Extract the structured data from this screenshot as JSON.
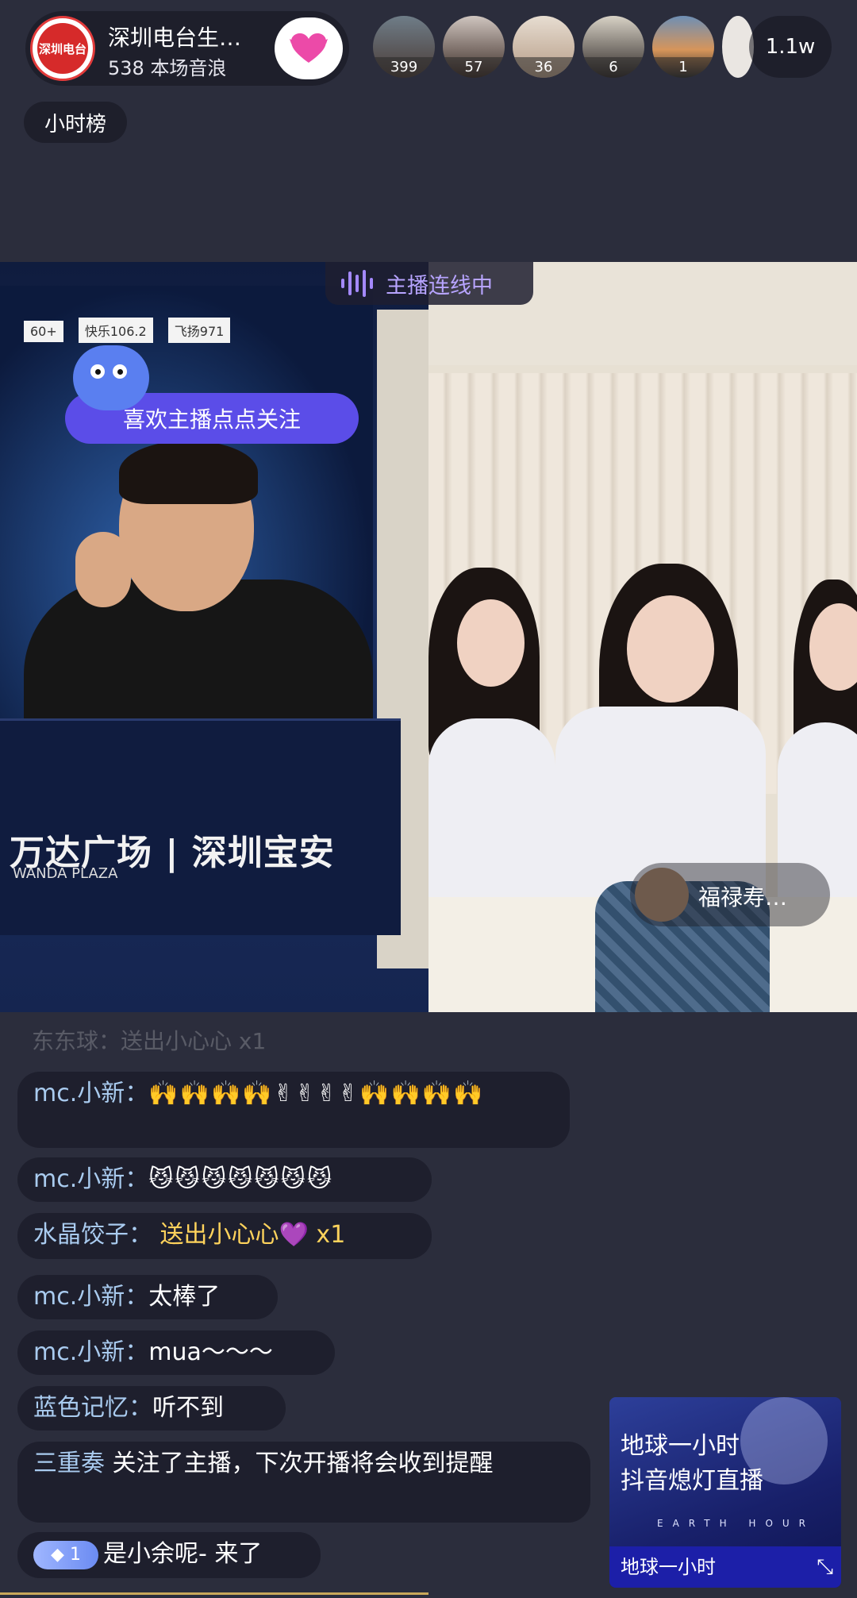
{
  "host": {
    "name": "深圳电台生…",
    "stat": "538 本场音浪",
    "logo_text": "深圳电台",
    "follow_icon": "heart-icon"
  },
  "viewers": [
    {
      "badge": "399"
    },
    {
      "badge": "57"
    },
    {
      "badge": "36"
    },
    {
      "badge": "6"
    },
    {
      "badge": "1"
    },
    {
      "badge": ""
    }
  ],
  "viewer_count": "1.1w",
  "rank_chip": "小时榜",
  "link_status": "主播连线中",
  "left_cam": {
    "hint": "喜欢主播点点关注",
    "podium_main": "万达广场 | 深圳宝安",
    "podium_sub": "WANDA PLAZA",
    "sponsors": [
      "60+",
      "快乐106.2",
      "飞扬971"
    ]
  },
  "guest": {
    "name": "福禄寿…"
  },
  "chat": {
    "faded": "东东球：送出小心心 x1",
    "messages": [
      {
        "user": "mc.小新：",
        "text": "🙌🙌🙌🙌✌✌✌✌🙌🙌🙌🙌"
      },
      {
        "user": "mc.小新：",
        "text": "😼😼😼😼😼😼😼"
      },
      {
        "user": "水晶饺子：",
        "gift": "送出小心心💜 x1"
      },
      {
        "user": "mc.小新：",
        "text": "太棒了"
      },
      {
        "user": "mc.小新：",
        "text": "mua～～～"
      },
      {
        "user": "蓝色记忆：",
        "text": "听不到"
      },
      {
        "user": "三重奏",
        "text": "关注了主播，下次开播将会收到提醒"
      },
      {
        "tier": "1",
        "user": "是小余呢-",
        "text": "来了"
      }
    ]
  },
  "promo": {
    "line1": "地球一小时",
    "line2": "抖音熄灯直播",
    "tag": "EARTH HOUR",
    "footer": "地球一小时",
    "expand_icon": "collapse-icon"
  },
  "colors": {
    "background": "#2b2d3c",
    "accent_purple": "#5b4de8",
    "gift_text": "#ffd35c",
    "username": "#a9cbef"
  }
}
